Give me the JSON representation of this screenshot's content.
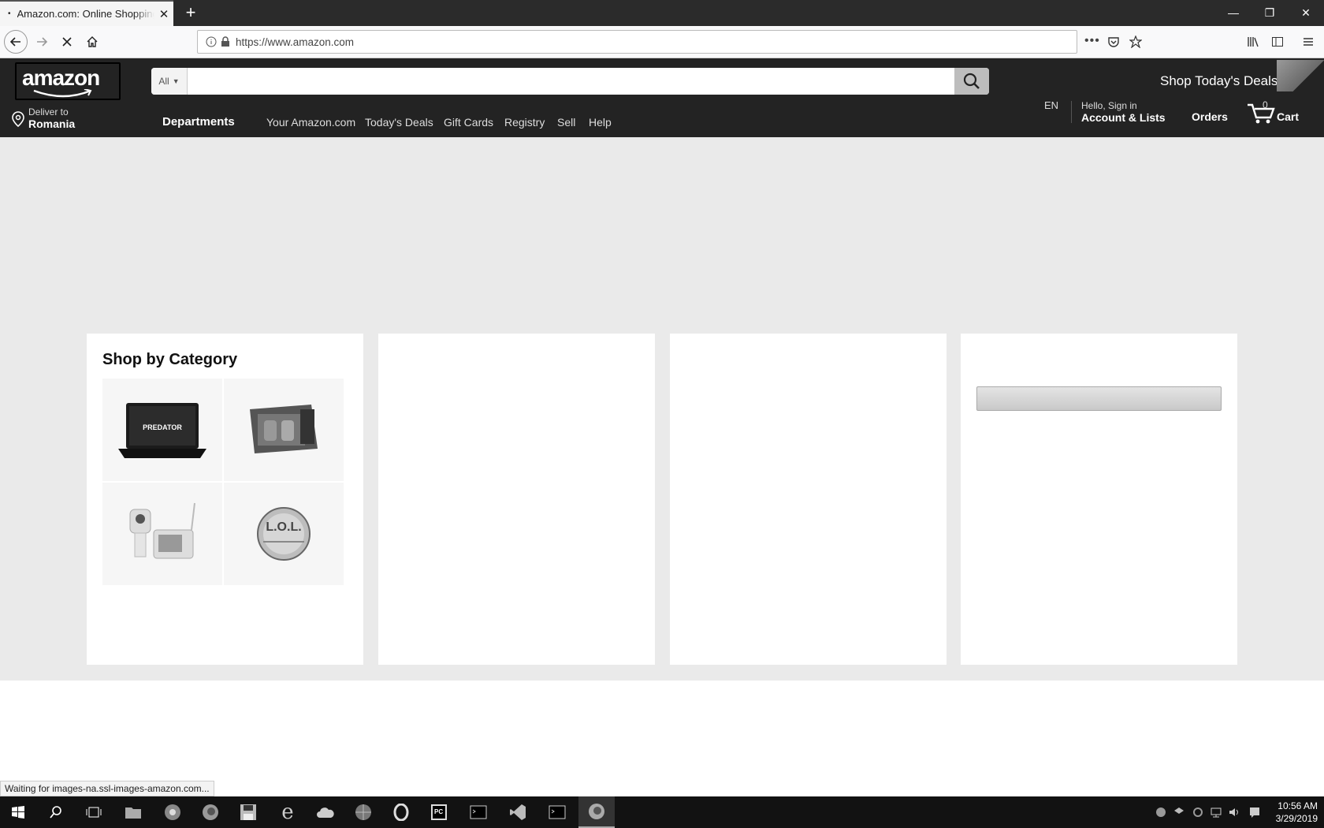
{
  "browser": {
    "tab_title": "Amazon.com: Online Shopping for Electronics",
    "url": "https://www.amazon.com",
    "status_text": "Waiting for images-na.ssl-images-amazon.com..."
  },
  "header": {
    "logo": "amazon",
    "search_category": "All",
    "search_placeholder": "",
    "promo": "Shop Today's Deals",
    "deliver_small": "Deliver to",
    "deliver_big": "Romania",
    "departments": "Departments",
    "nav": [
      "Your Amazon.com",
      "Today's Deals",
      "Gift Cards",
      "Registry",
      "Sell",
      "Help"
    ],
    "language": "EN",
    "account_small": "Hello, Sign in",
    "account_big": "Account & Lists",
    "orders": "Orders",
    "cart_count": "0",
    "cart_label": "Cart"
  },
  "main": {
    "card1_title": "Shop by Category",
    "categories": [
      {
        "icon": "laptop-icon",
        "label": "PREDATOR"
      },
      {
        "icon": "game-console-icon",
        "label": ""
      },
      {
        "icon": "baby-monitor-icon",
        "label": ""
      },
      {
        "icon": "toy-ball-icon",
        "label": "L.O.L."
      }
    ]
  },
  "taskbar": {
    "time": "10:56 AM",
    "date": "3/29/2019"
  }
}
